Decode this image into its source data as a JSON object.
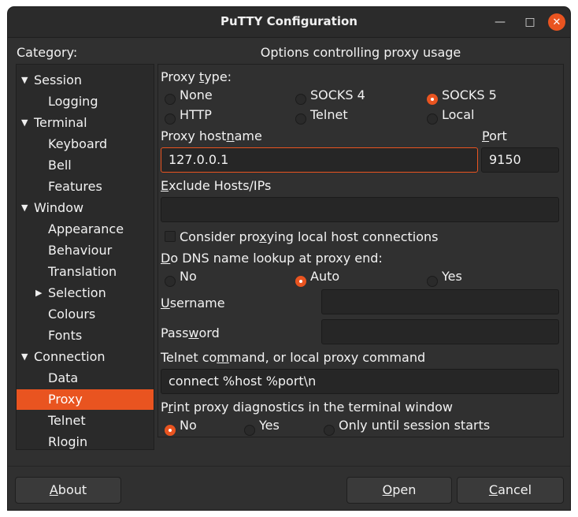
{
  "window": {
    "title": "PuTTY Configuration",
    "controls": {
      "minimize": "—",
      "maximize": "□",
      "close": "✕"
    }
  },
  "category_label": "Category:",
  "options_title": "Options controlling proxy usage",
  "tree": [
    {
      "label": "Session",
      "expanded": true
    },
    {
      "label": "Logging"
    },
    {
      "label": "Terminal",
      "expanded": true
    },
    {
      "label": "Keyboard"
    },
    {
      "label": "Bell"
    },
    {
      "label": "Features"
    },
    {
      "label": "Window",
      "expanded": true
    },
    {
      "label": "Appearance"
    },
    {
      "label": "Behaviour"
    },
    {
      "label": "Translation"
    },
    {
      "label": "Selection",
      "expanded": false
    },
    {
      "label": "Colours"
    },
    {
      "label": "Fonts"
    },
    {
      "label": "Connection",
      "expanded": true
    },
    {
      "label": "Data"
    },
    {
      "label": "Proxy",
      "selected": true
    },
    {
      "label": "Telnet"
    },
    {
      "label": "Rlogin"
    }
  ],
  "proxy_type": {
    "label_pre": "Proxy ",
    "label_u": "t",
    "label_post": "ype:",
    "options": [
      "None",
      "SOCKS 4",
      "SOCKS 5",
      "HTTP",
      "Telnet",
      "Local"
    ],
    "selected": "SOCKS 5"
  },
  "hostname": {
    "label_pre": "Proxy host",
    "label_u": "n",
    "label_post": "ame",
    "value": "127.0.0.1"
  },
  "port": {
    "label_pre": "",
    "label_u": "P",
    "label_post": "ort",
    "value": "9150"
  },
  "exclude": {
    "label_pre": "",
    "label_u": "E",
    "label_post": "xclude Hosts/IPs",
    "value": ""
  },
  "consider_local": {
    "label_pre": "Consider pro",
    "label_u": "x",
    "label_post": "ying local host connections",
    "checked": false
  },
  "dns": {
    "label_pre": "",
    "label_u": "D",
    "label_post": "o DNS name lookup at proxy end:",
    "options": [
      "No",
      "Auto",
      "Yes"
    ],
    "selected": "Auto"
  },
  "username": {
    "label_pre": "",
    "label_u": "U",
    "label_post": "sername",
    "value": ""
  },
  "password": {
    "label_pre": "Pass",
    "label_u": "w",
    "label_post": "ord",
    "value": ""
  },
  "telnet_cmd": {
    "label_pre": "Telnet co",
    "label_u": "m",
    "label_post": "mand, or local proxy command",
    "value": "connect %host %port\\n"
  },
  "diagnostics": {
    "label_pre": "P",
    "label_u": "r",
    "label_post": "int proxy diagnostics in the terminal window",
    "options": [
      "No",
      "Yes",
      "Only until session starts"
    ],
    "selected": "No"
  },
  "buttons": {
    "about_u": "A",
    "about_rest": "bout",
    "open_u": "O",
    "open_rest": "pen",
    "cancel_u": "C",
    "cancel_rest": "ancel"
  },
  "colors": {
    "accent": "#e95420",
    "window_bg": "#303030",
    "field_bg": "#262626"
  }
}
